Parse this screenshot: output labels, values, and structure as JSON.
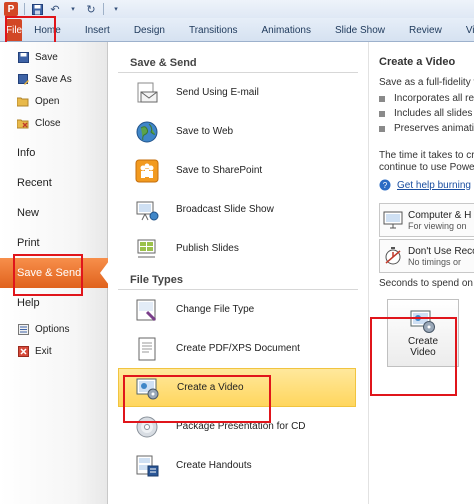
{
  "qat": {
    "app_letter": "P"
  },
  "ribbon": {
    "file_tab": "File",
    "tabs": [
      "Home",
      "Insert",
      "Design",
      "Transitions",
      "Animations",
      "Slide Show",
      "Review",
      "Vi"
    ]
  },
  "leftnav": {
    "small_items": [
      {
        "label": "Save",
        "icon": "save-icon"
      },
      {
        "label": "Save As",
        "icon": "save-as-icon"
      },
      {
        "label": "Open",
        "icon": "open-folder-icon"
      },
      {
        "label": "Close",
        "icon": "close-folder-icon"
      }
    ],
    "big_items": [
      "Info",
      "Recent",
      "New",
      "Print",
      "Save & Send",
      "Help"
    ],
    "bottom_items": [
      {
        "label": "Options",
        "icon": "options-icon"
      },
      {
        "label": "Exit",
        "icon": "exit-icon"
      }
    ],
    "selected": "Save & Send"
  },
  "middle": {
    "save_send_heading": "Save & Send",
    "save_send_items": [
      "Send Using E-mail",
      "Save to Web",
      "Save to SharePoint",
      "Broadcast Slide Show",
      "Publish Slides"
    ],
    "file_types_heading": "File Types",
    "file_types_items": [
      "Change File Type",
      "Create PDF/XPS Document",
      "Create a Video",
      "Package Presentation for CD",
      "Create Handouts"
    ],
    "selected": "Create a Video"
  },
  "right": {
    "title": "Create a Video",
    "intro": "Save as a full-fidelity vi",
    "bullets": [
      "Incorporates all re",
      "Includes all slides",
      "Preserves animati"
    ],
    "time_line1": "The time it takes to cre",
    "time_line2": "continue to use Power",
    "help_link": "Get help burning",
    "quality_title": "Computer & H",
    "quality_sub": "For viewing on",
    "timing_title": "Don't Use Reco",
    "timing_sub": "No timings or",
    "seconds_label": "Seconds to spend on e",
    "create_label_1": "Create",
    "create_label_2": "Video"
  },
  "colors": {
    "file_orange": "#d24726",
    "highlight_red": "#e0151b",
    "selected_yellow": "#ffd65e"
  }
}
